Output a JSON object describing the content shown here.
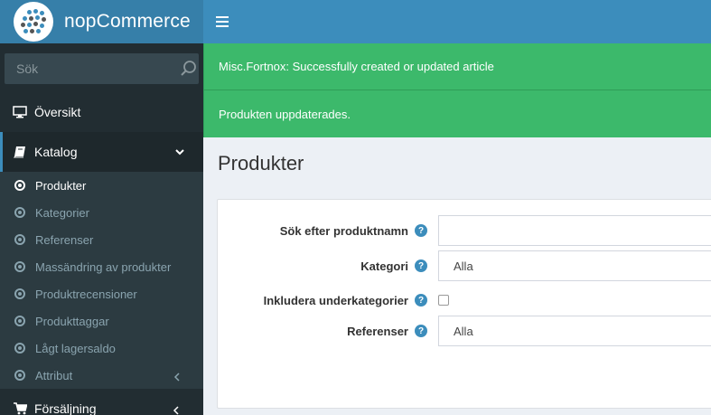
{
  "brand": {
    "name": "nopCommerce"
  },
  "sidebar": {
    "search_placeholder": "Sök",
    "items": [
      {
        "label": "Översikt",
        "icon": "monitor-icon"
      },
      {
        "label": "Katalog",
        "icon": "book-icon"
      }
    ],
    "catalog_sub": [
      {
        "label": "Produkter"
      },
      {
        "label": "Kategorier"
      },
      {
        "label": "Referenser"
      },
      {
        "label": "Massändring av produkter"
      },
      {
        "label": "Produktrecensioner"
      },
      {
        "label": "Produkttaggar"
      },
      {
        "label": "Lågt lagersaldo"
      },
      {
        "label": "Attribut"
      }
    ],
    "sales": {
      "label": "Försäljning",
      "icon": "cart-icon"
    }
  },
  "alerts": [
    {
      "text": "Misc.Fortnox: Successfully created or updated article"
    },
    {
      "text": "Produkten uppdaterades."
    }
  ],
  "page": {
    "title": "Produkter"
  },
  "form": {
    "search_name_label": "Sök efter produktnamn",
    "search_name_value": "",
    "category_label": "Kategori",
    "category_value": "Alla",
    "subcategories_label": "Inkludera underkategorier",
    "manufacturer_label": "Referenser",
    "manufacturer_value": "Alla",
    "help_glyph": "?"
  },
  "colors": {
    "header": "#3c8dbc",
    "sidebar": "#222d32",
    "success": "#3cb96b"
  }
}
